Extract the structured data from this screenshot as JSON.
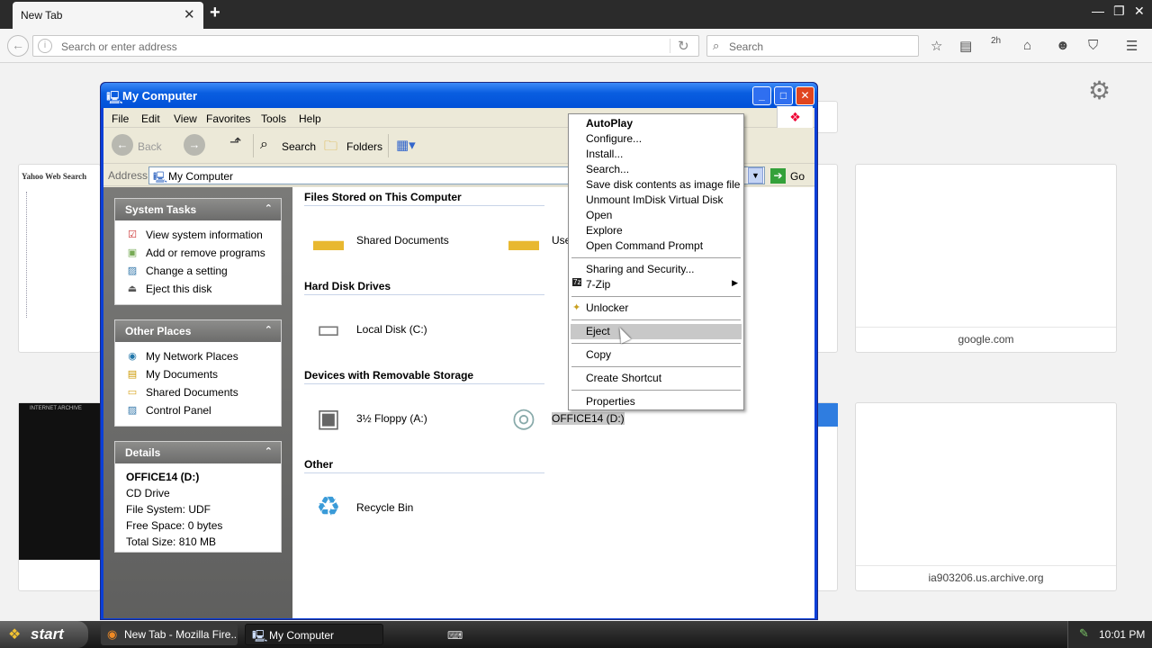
{
  "browser": {
    "tab_title": "New Tab",
    "address_placeholder": "Search or enter address",
    "search_placeholder": "Search",
    "toolbar_badge": "2h"
  },
  "tiles": [
    {
      "label": "Yahoo Web Search"
    },
    {
      "label": "google.com"
    },
    {
      "label": "ia903206.us.archive.org"
    },
    {
      "label": "INTERNET ARCHIVE"
    }
  ],
  "window": {
    "title": "My Computer",
    "menu": [
      "File",
      "Edit",
      "View",
      "Favorites",
      "Tools",
      "Help"
    ],
    "toolbar": {
      "back": "Back",
      "search": "Search",
      "folders": "Folders"
    },
    "address_label": "Address",
    "address_value": "My Computer",
    "go_label": "Go"
  },
  "system_tasks": {
    "title": "System Tasks",
    "items": [
      "View system information",
      "Add or remove programs",
      "Change a setting",
      "Eject this disk"
    ]
  },
  "other_places": {
    "title": "Other Places",
    "items": [
      "My Network Places",
      "My Documents",
      "Shared Documents",
      "Control Panel"
    ]
  },
  "details": {
    "title": "Details",
    "name": "OFFICE14 (D:)",
    "type": "CD Drive",
    "filesystem": "File System: UDF",
    "free": "Free Space: 0 bytes",
    "total": "Total Size: 810 MB"
  },
  "groups": {
    "files": "Files Stored on This Computer",
    "hdd": "Hard Disk Drives",
    "removable": "Devices with Removable Storage",
    "other": "Other"
  },
  "items": {
    "shared_docs": "Shared Documents",
    "user_docs": "User",
    "local_disk": "Local Disk (C:)",
    "floppy": "3½ Floppy (A:)",
    "cd": "OFFICE14 (D:)",
    "recycle": "Recycle Bin"
  },
  "context_menu": {
    "autoplay": "AutoPlay",
    "configure": "Configure...",
    "install": "Install...",
    "search": "Search...",
    "save_image": "Save disk contents as image file",
    "unmount": "Unmount ImDisk Virtual Disk",
    "open": "Open",
    "explore": "Explore",
    "cmd": "Open Command Prompt",
    "sharing": "Sharing and Security...",
    "zip": "7-Zip",
    "unlocker": "Unlocker",
    "eject": "Eject",
    "copy": "Copy",
    "shortcut": "Create Shortcut",
    "properties": "Properties"
  },
  "taskbar": {
    "start": "start",
    "task_firefox": "New Tab - Mozilla Fire...",
    "task_mycomputer": "My Computer",
    "clock": "10:01 PM"
  }
}
